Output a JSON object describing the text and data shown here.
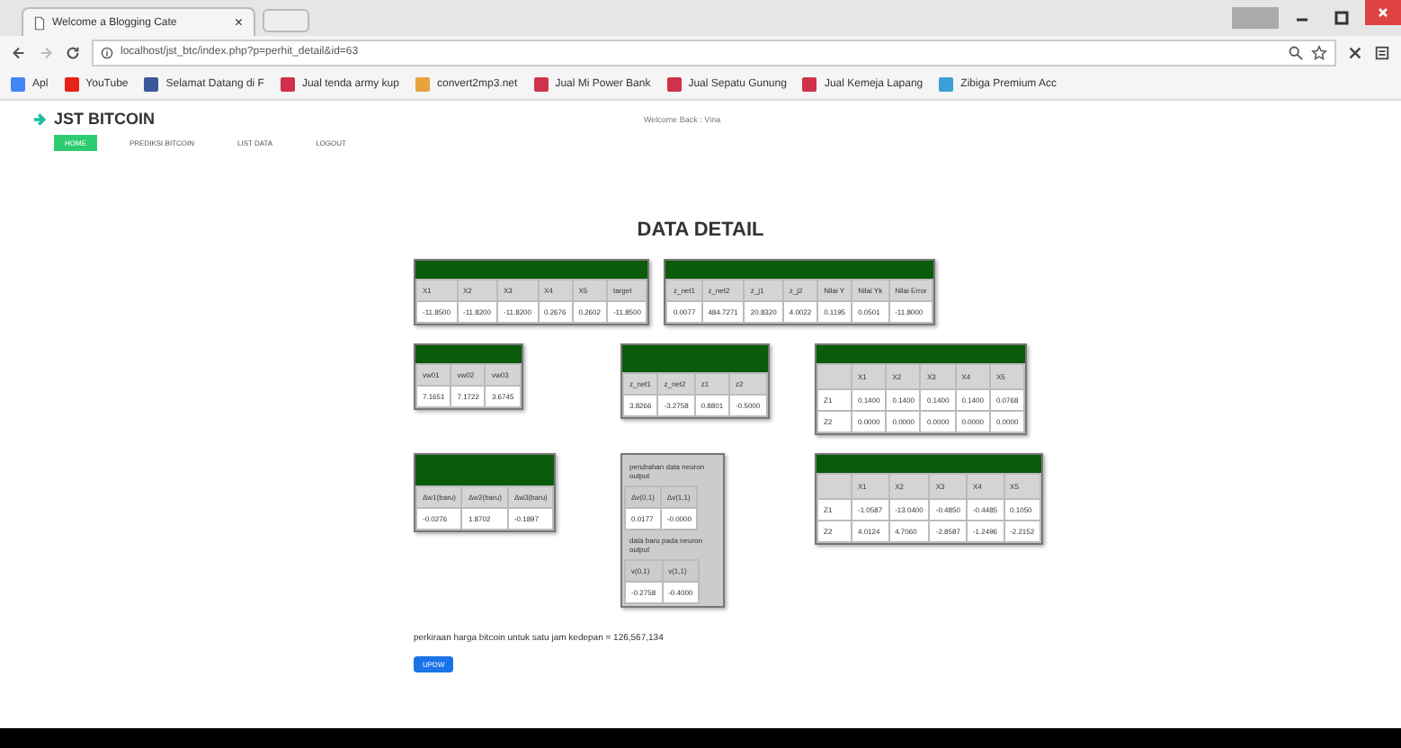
{
  "browser": {
    "tab_title": "Welcome a Blogging Cate",
    "close": "×",
    "url": "localhost/jst_btc/index.php?p=perhit_detail&id=63",
    "bookmarks": [
      {
        "label": "Apl",
        "color": "#4285f4"
      },
      {
        "label": "YouTube",
        "color": "#e62117"
      },
      {
        "label": "Selamat Datang di F",
        "color": "#3b5998"
      },
      {
        "label": "Jual tenda army kup",
        "color": "#d0314b"
      },
      {
        "label": "convert2mp3.net",
        "color": "#e8a33c"
      },
      {
        "label": "Jual Mi Power Bank",
        "color": "#d0314b"
      },
      {
        "label": "Jual Sepatu Gunung",
        "color": "#d0314b"
      },
      {
        "label": "Jual Kemeja Lapang",
        "color": "#d0314b"
      },
      {
        "label": "Zibiga Premium Acc",
        "color": "#3aa0d8"
      }
    ]
  },
  "header": {
    "brand": "JST BITCOIN",
    "welcome": "Welcome Back : Vina"
  },
  "menu": [
    {
      "label": "HOME",
      "selected": true
    },
    {
      "label": "PREDIKSI BITCOIN",
      "selected": false
    },
    {
      "label": "LIST DATA",
      "selected": false
    },
    {
      "label": "LOGOUT",
      "selected": false
    }
  ],
  "title": "DATA DETAIL",
  "tables": [
    {
      "kind": "matrix",
      "columns": [
        "X1",
        "X2",
        "X3",
        "X4",
        "X5",
        "target"
      ],
      "rows": [
        [
          "-11.8500",
          "-11.8200",
          "-11.8200",
          "0.2676",
          "0.2602",
          "-11.8500"
        ]
      ]
    },
    {
      "kind": "matrix",
      "columns": [
        "z_net1",
        "z_net2",
        "z_j1",
        "z_j2",
        "Nilai Y",
        "Nilai Yk",
        "Nilai Error"
      ],
      "rows": [
        [
          "0.0077",
          "484.7271",
          "20.8320",
          "4.0022",
          "0.1195",
          "0.0501",
          "-11.8000"
        ]
      ]
    },
    {
      "kind": "matrix",
      "columns": [
        "vw01",
        "vw02",
        "vw03"
      ],
      "rows": [
        [
          "7.1651",
          "7.1722",
          "3.6745"
        ]
      ]
    },
    {
      "kind": "matrix",
      "columns": [
        "z_net1",
        "z_net2",
        "z1",
        "z2"
      ],
      "rows": [
        [
          "3.8266",
          "-3.2758",
          "0.8801",
          "-0.5000"
        ]
      ]
    },
    {
      "kind": "matrix",
      "columns": [
        "",
        "X1",
        "X2",
        "X3",
        "X4",
        "X5"
      ],
      "rows": [
        [
          "Z1",
          "0.1400",
          "0.1400",
          "0.1400",
          "0.1400",
          "0.0768"
        ],
        [
          "Z2",
          "0.0000",
          "0.0000",
          "0.0000",
          "0.0000",
          "0.0000"
        ]
      ]
    },
    {
      "kind": "matrix",
      "columns": [
        "Δw1(baru)",
        "Δw2(baru)",
        "Δw3(baru)"
      ],
      "rows": [
        [
          "-0.0276",
          "1.8702",
          "-0.1897"
        ]
      ]
    },
    {
      "kind": "sections",
      "sections": [
        {
          "caption": "perubahan data neuron output",
          "columns": [
            "Δv(0,1)",
            "Δv(1,1)"
          ],
          "rows": [
            [
              "0.0177",
              "-0.0000"
            ]
          ]
        },
        {
          "caption": "data baru pada neuron output",
          "columns": [
            "v(0,1)",
            "v(1,1)"
          ],
          "rows": [
            [
              "-0.2758",
              "-0.4000"
            ]
          ]
        }
      ]
    },
    {
      "kind": "matrix",
      "columns": [
        "",
        "X1",
        "X2",
        "X3",
        "X4",
        "X5"
      ],
      "rows": [
        [
          "Z1",
          "-1.0587",
          "-13.0400",
          "-0.4850",
          "-0.4485",
          "0.1050"
        ],
        [
          "Z2",
          "4.0124",
          "4.7060",
          "-2.8587",
          "-1.2496",
          "-2.2152"
        ]
      ]
    }
  ],
  "result": "perkiraan harga bitcoin untuk satu jam kedepan = 126,567,134",
  "button": "UPDW"
}
